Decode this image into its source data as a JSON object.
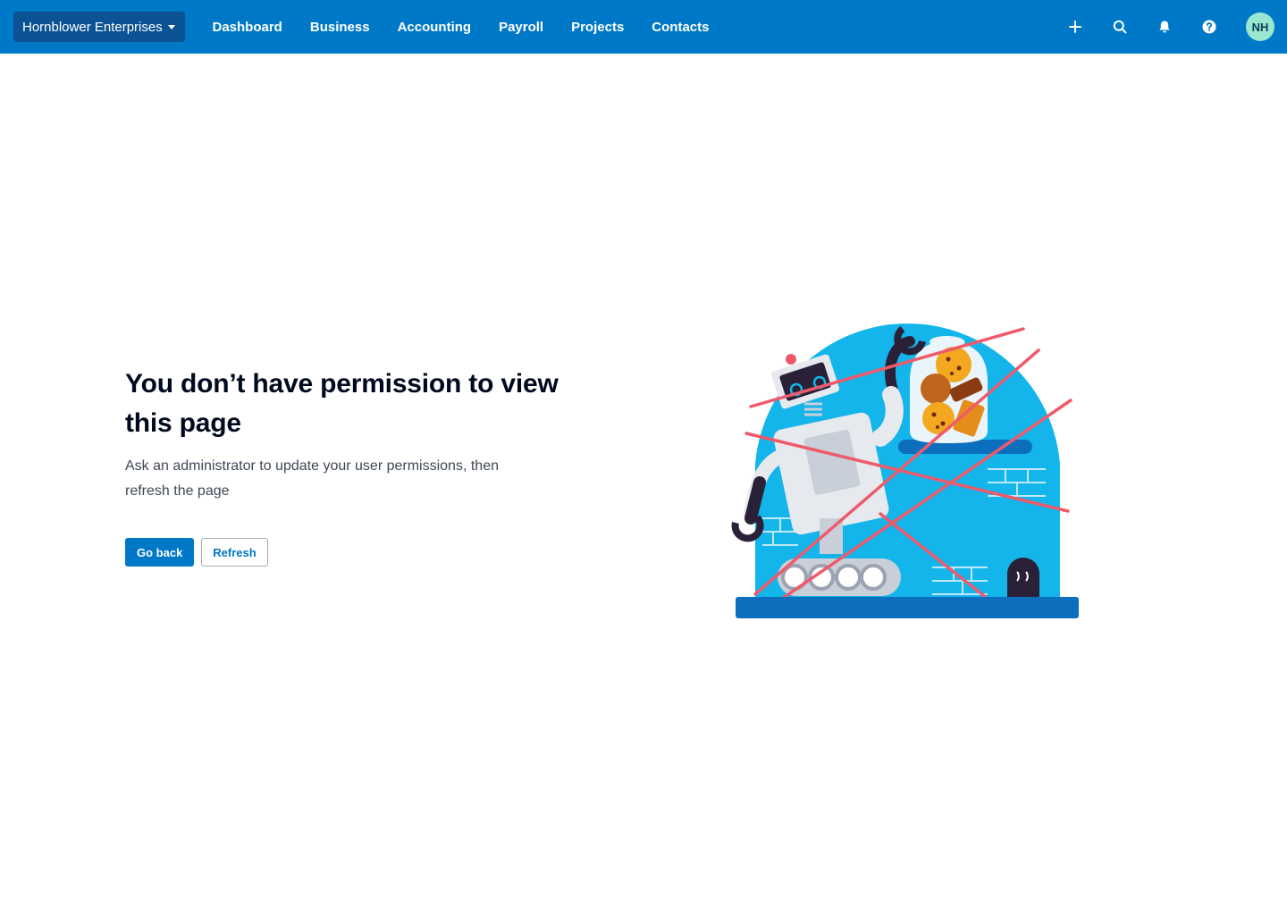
{
  "header": {
    "org_name": "Hornblower Enterprises",
    "nav": [
      {
        "label": "Dashboard"
      },
      {
        "label": "Business"
      },
      {
        "label": "Accounting"
      },
      {
        "label": "Payroll"
      },
      {
        "label": "Projects"
      },
      {
        "label": "Contacts"
      }
    ],
    "actions": [
      "plus-icon",
      "search-icon",
      "bell-icon",
      "help-icon"
    ],
    "avatar_initials": "NH"
  },
  "main": {
    "title": "You don’t have permission to view this page",
    "message": "Ask an administrator to update your user permissions, then refresh the page",
    "go_back_label": "Go back",
    "refresh_label": "Refresh"
  },
  "colors": {
    "brand_blue": "#0078c8",
    "org_switcher": "#0b5394",
    "avatar_bg": "#9ae7cf",
    "illustration_sky": "#13b5ea"
  }
}
